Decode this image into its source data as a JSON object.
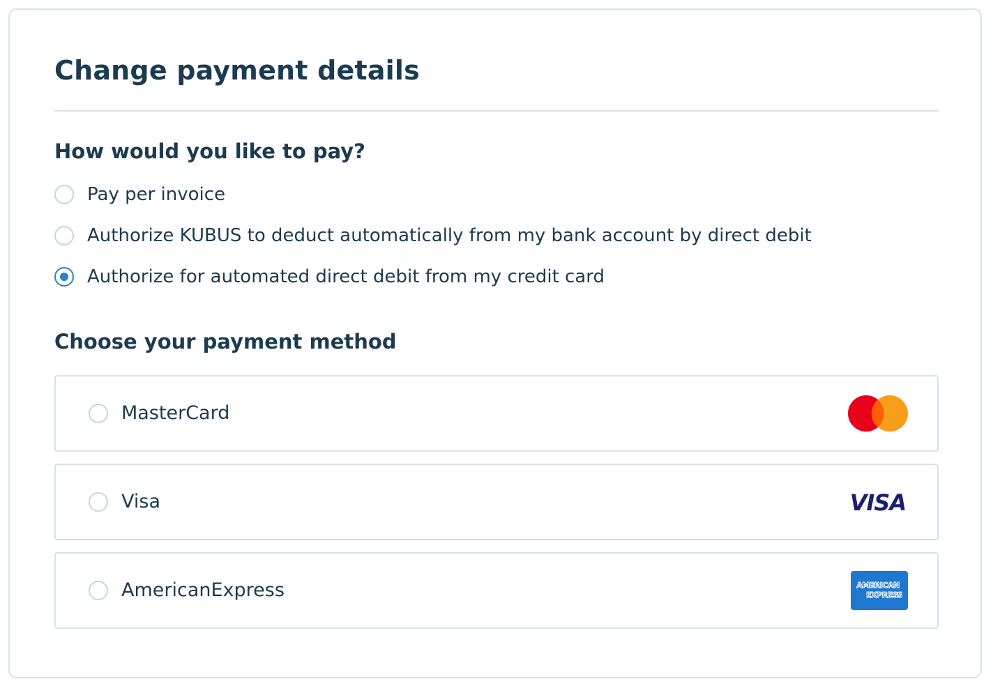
{
  "page": {
    "title": "Change payment details"
  },
  "pay_section": {
    "heading": "How would you like to pay?",
    "options": [
      {
        "label": "Pay per invoice",
        "selected": false
      },
      {
        "label": "Authorize KUBUS to deduct automatically from my bank account by direct debit",
        "selected": false
      },
      {
        "label": "Authorize for automated direct debit from my credit card",
        "selected": true
      }
    ]
  },
  "method_section": {
    "heading": "Choose your payment method",
    "methods": [
      {
        "label": "MasterCard",
        "logo": "mastercard-logo",
        "selected": false
      },
      {
        "label": "Visa",
        "logo": "visa-logo",
        "selected": false,
        "logo_text": "VISA"
      },
      {
        "label": "AmericanExpress",
        "logo": "amex-logo",
        "selected": false,
        "logo_text_1": "AMERICAN",
        "logo_text_2": "EXPRESS"
      }
    ]
  },
  "colors": {
    "text": "#1b3b50",
    "border": "#d6e2ea",
    "radio_selected": "#2a82c4",
    "mastercard_red": "#eb001b",
    "mastercard_orange": "#f79e1b",
    "visa_navy": "#1a1f71",
    "amex_blue": "#1e78d0"
  }
}
